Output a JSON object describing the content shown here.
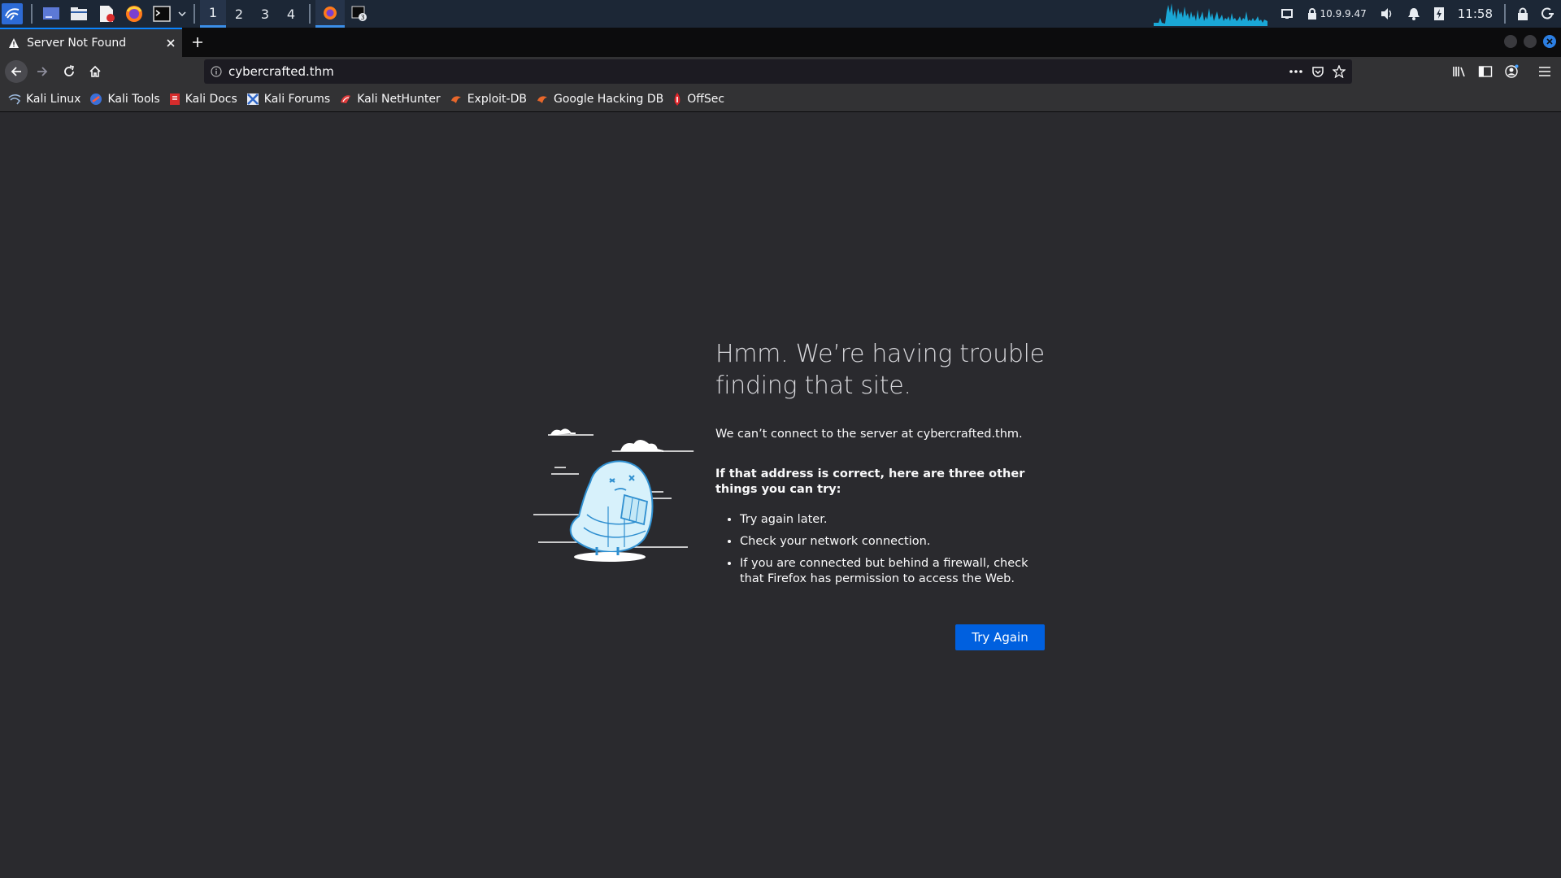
{
  "panel": {
    "workspaces": [
      "1",
      "2",
      "3",
      "4"
    ],
    "active_workspace": "1",
    "tray": {
      "ip": "10.9.9.47",
      "time": "11:58"
    }
  },
  "browser": {
    "tab": {
      "title": "Server Not Found"
    },
    "url": "cybercrafted.thm",
    "bookmarks": [
      {
        "label": "Kali Linux",
        "icon": "kali-dragon-icon"
      },
      {
        "label": "Kali Tools",
        "icon": "kali-tools-icon"
      },
      {
        "label": "Kali Docs",
        "icon": "kali-docs-icon"
      },
      {
        "label": "Kali Forums",
        "icon": "kali-forums-icon"
      },
      {
        "label": "Kali NetHunter",
        "icon": "nethunter-icon"
      },
      {
        "label": "Exploit-DB",
        "icon": "exploit-db-icon"
      },
      {
        "label": "Google Hacking DB",
        "icon": "ghdb-icon"
      },
      {
        "label": "OffSec",
        "icon": "offsec-icon"
      }
    ]
  },
  "error_page": {
    "title": "Hmm. We’re having trouble finding that site.",
    "description": "We can’t connect to the server at cybercrafted.thm.",
    "suggestions_heading": "If that address is correct, here are three other things you can try:",
    "suggestions": [
      "Try again later.",
      "Check your network connection.",
      "If you are connected but behind a firewall, check that Firefox has permission to access the Web."
    ],
    "button_label": "Try Again"
  },
  "colors": {
    "panel_bg": "#1c2736",
    "accent": "#0a84ff",
    "page_bg": "#2a2a2e",
    "button_bg": "#0060df"
  }
}
